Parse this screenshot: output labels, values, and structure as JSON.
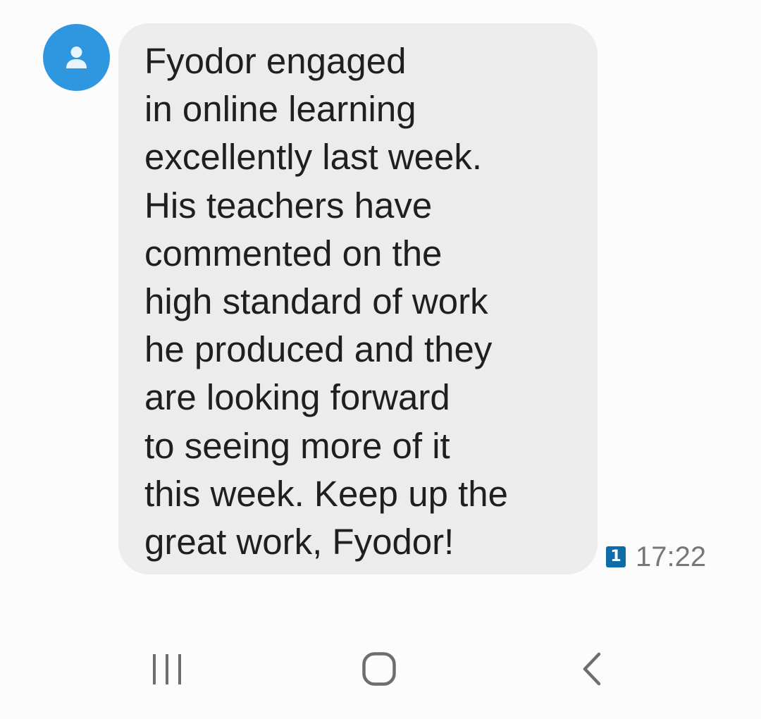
{
  "conversation": {
    "message": {
      "lines": [
        "Fyodor engaged",
        "in online learning",
        "excellently last week.",
        "His teachers have",
        "commented on the",
        "high standard of work",
        "he produced and they",
        "are looking forward",
        "to seeing more of it",
        "this week. Keep up the",
        "great work, Fyodor!"
      ],
      "sim_slot": "1",
      "time": "17:22"
    },
    "avatar_icon": "person-icon"
  },
  "nav_bar": {
    "recents_icon": "recents-icon",
    "home_icon": "home-icon",
    "back_icon": "back-icon"
  },
  "colors": {
    "avatar": "#2f97df",
    "bubble": "#ececec",
    "sim_badge": "#0f6ca8",
    "timestamp": "#777777",
    "nav_icons": "#6e6e6e"
  }
}
